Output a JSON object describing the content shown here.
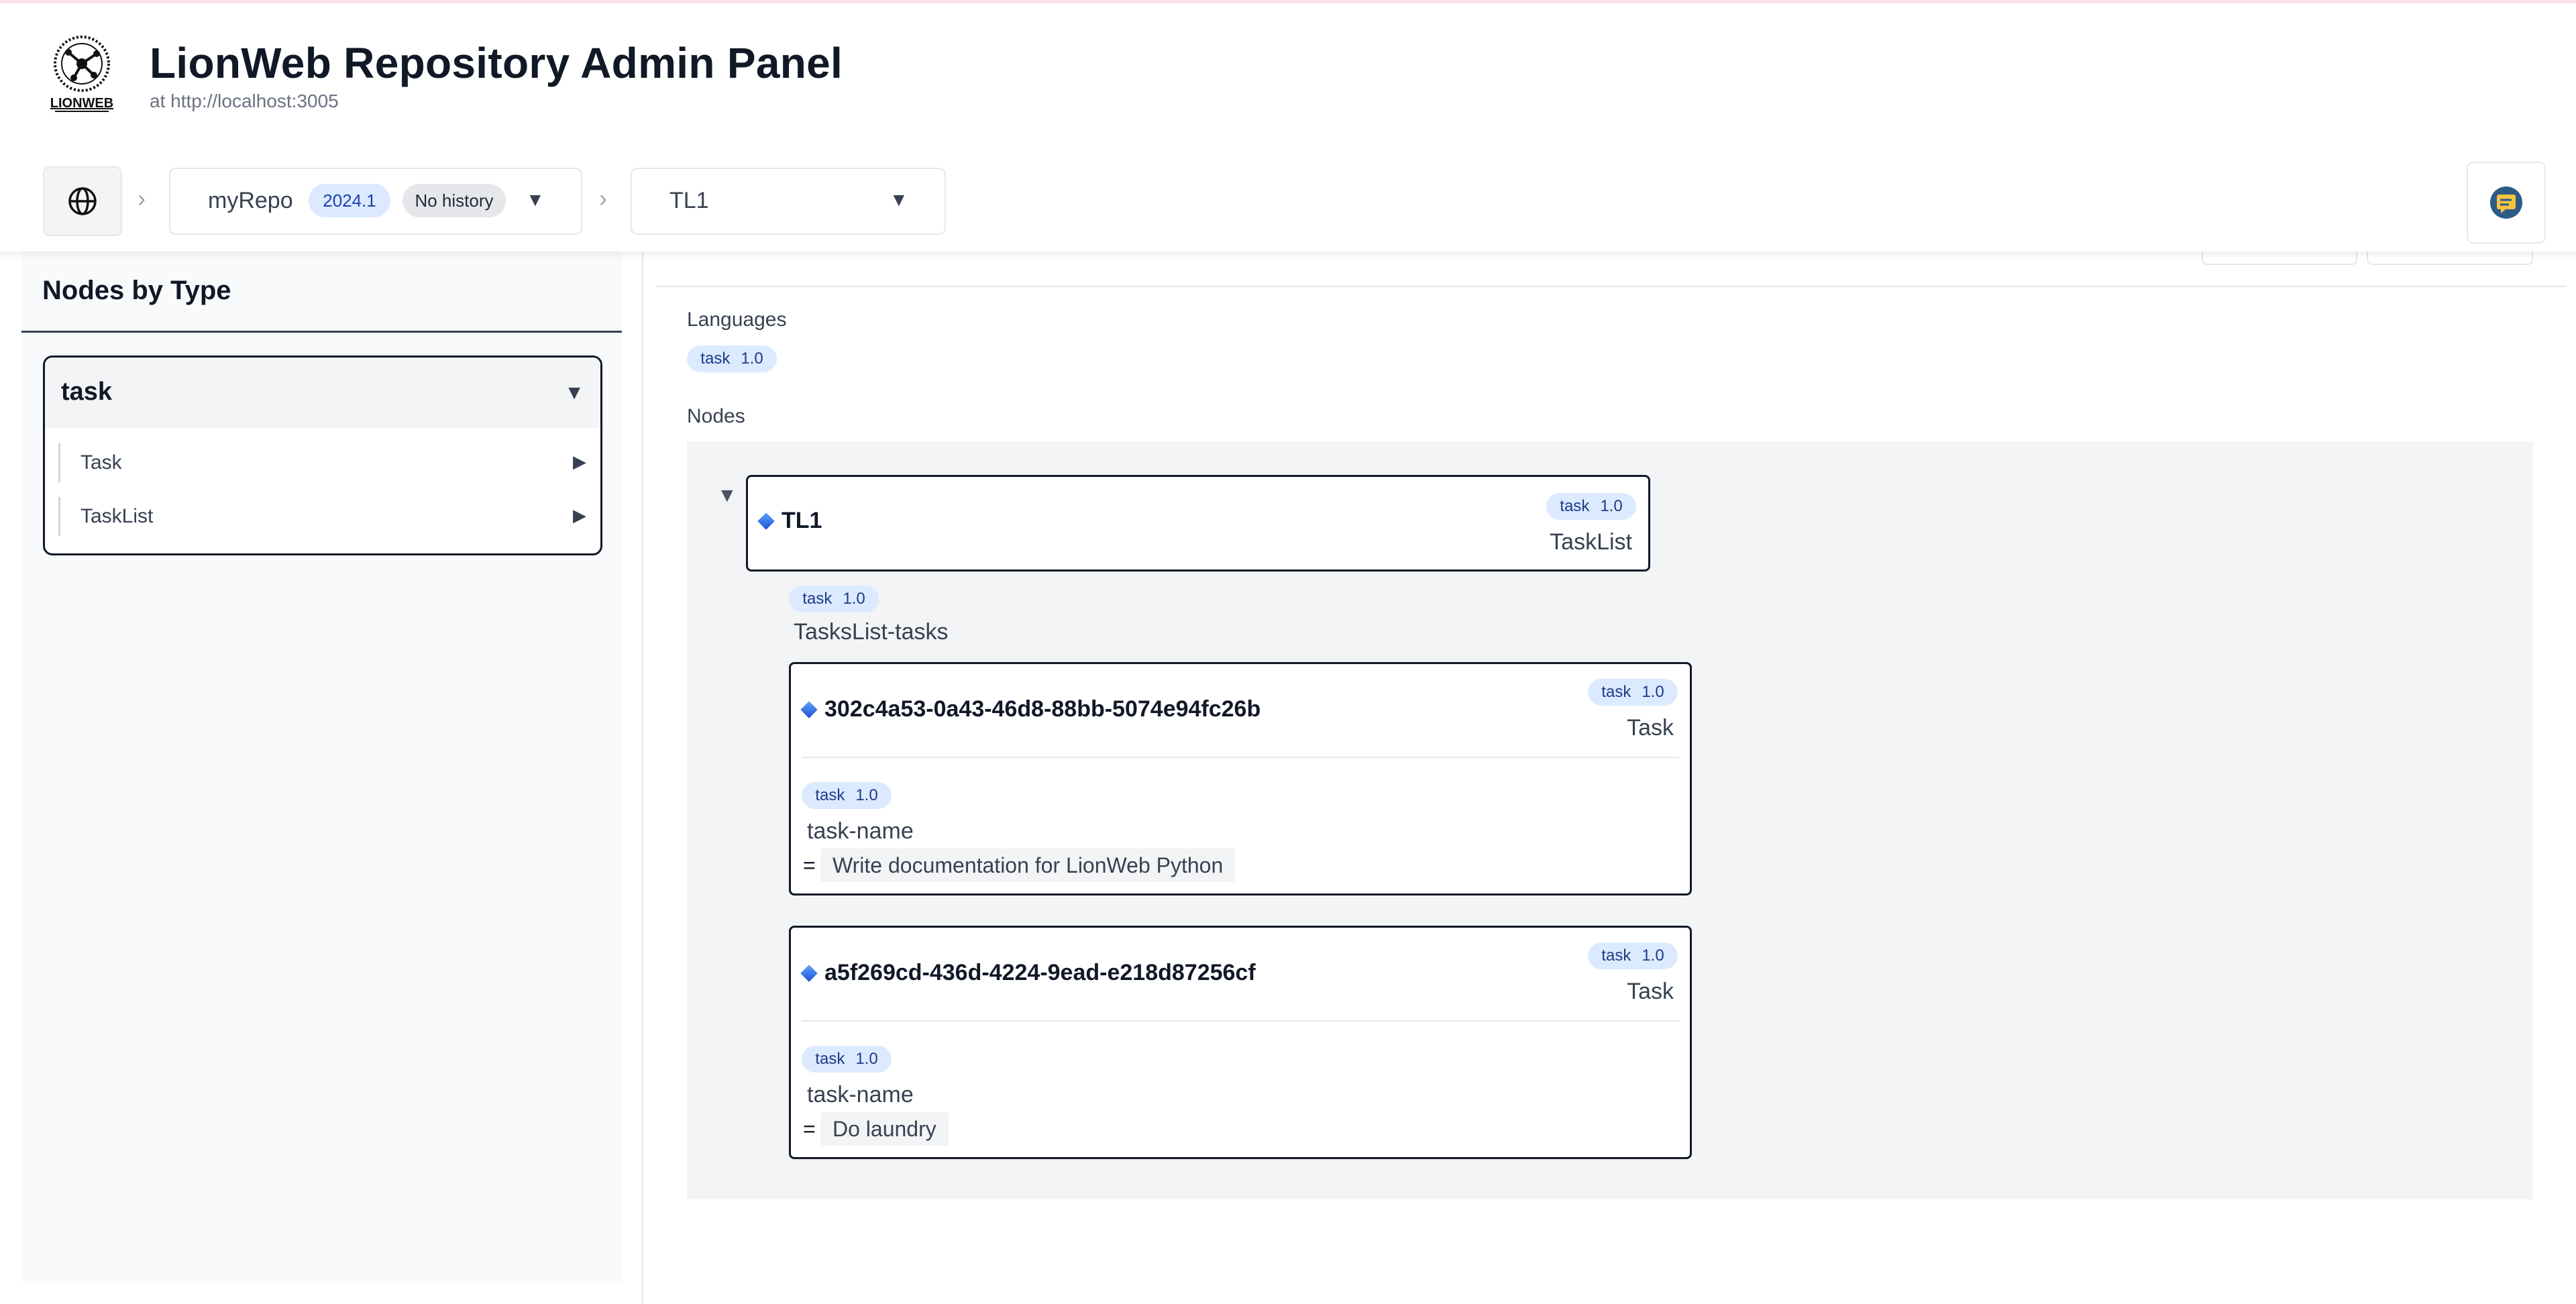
{
  "header": {
    "title": "LionWeb Repository Admin Panel",
    "subtitle": "at http://localhost:3005",
    "logo_text": "LIONWEB",
    "globe_icon": "globe-icon",
    "action_icon": "message-icon"
  },
  "repo_selector": {
    "name": "myRepo",
    "version": "2024.1",
    "history": "No history"
  },
  "node_selector": {
    "selected": "TL1"
  },
  "sidebar": {
    "title": "Nodes by Type",
    "groups": [
      {
        "name": "task",
        "types": [
          {
            "label": "Task"
          },
          {
            "label": "TaskList"
          }
        ]
      }
    ]
  },
  "main": {
    "languages_label": "Languages",
    "languages": [
      {
        "key": "task",
        "version": "1.0"
      }
    ],
    "nodes_label": "Nodes",
    "root": {
      "id": "TL1",
      "lang": "task",
      "version": "1.0",
      "concept": "TaskList",
      "containment": {
        "lang": "task",
        "version": "1.0",
        "name": "TasksList-tasks",
        "children": [
          {
            "id": "302c4a53-0a43-46d8-88bb-5074e94fc26b",
            "lang": "task",
            "version": "1.0",
            "concept": "Task",
            "property": {
              "lang": "task",
              "version": "1.0",
              "name": "task-name",
              "value": "Write documentation for LionWeb Python"
            }
          },
          {
            "id": "a5f269cd-436d-4224-9ead-e218d87256cf",
            "lang": "task",
            "version": "1.0",
            "concept": "Task",
            "property": {
              "lang": "task",
              "version": "1.0",
              "name": "task-name",
              "value": "Do laundry"
            }
          }
        ]
      }
    }
  },
  "colors": {
    "accent_badge_bg": "#dbeafe",
    "accent_badge_text": "#1e40af",
    "border_dark": "#111827",
    "panel_bg": "#f3f4f6"
  }
}
